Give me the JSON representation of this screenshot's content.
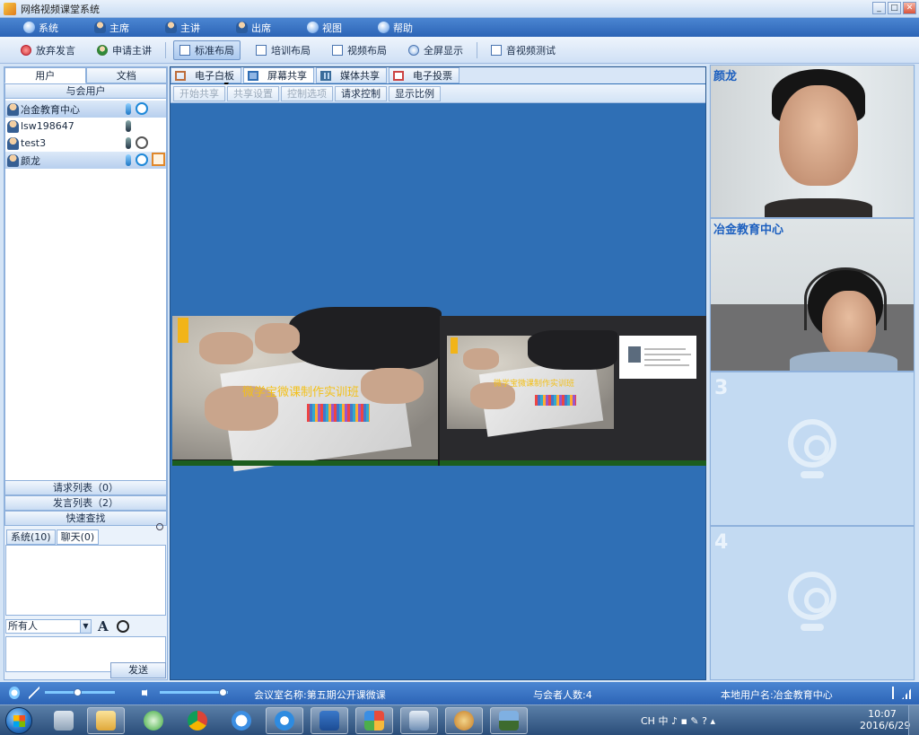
{
  "window": {
    "title": "网络视频课堂系统",
    "controls": [
      "_",
      "□",
      "✕"
    ]
  },
  "menu": [
    {
      "label": "系统",
      "icon": "gear-icon"
    },
    {
      "label": "主席",
      "icon": "person-icon"
    },
    {
      "label": "主讲",
      "icon": "person-icon"
    },
    {
      "label": "出席",
      "icon": "person-icon"
    },
    {
      "label": "视图",
      "icon": "monitor-icon"
    },
    {
      "label": "帮助",
      "icon": "info-icon"
    }
  ],
  "toolbar": [
    {
      "label": "放弃发言",
      "icon": "mic-off-icon",
      "active": false
    },
    {
      "label": "申请主讲",
      "icon": "user-icon",
      "active": false
    },
    {
      "label": "标准布局",
      "icon": "layout-icon",
      "active": true
    },
    {
      "label": "培训布局",
      "icon": "layout-icon",
      "active": false
    },
    {
      "label": "视频布局",
      "icon": "grid-icon",
      "active": false
    },
    {
      "label": "全屏显示",
      "icon": "fullscreen-icon",
      "active": false
    },
    {
      "label": "音视频测试",
      "icon": "av-test-icon",
      "active": false
    }
  ],
  "left": {
    "tabs": [
      "用户",
      "文档"
    ],
    "attendees_header": "与会用户",
    "users": [
      {
        "name": "冶金教育中心",
        "highlight": true
      },
      {
        "name": "lsw198647",
        "highlight": false
      },
      {
        "name": "test3",
        "highlight": false
      },
      {
        "name": "颜龙",
        "highlight": true
      }
    ],
    "request_list": "请求列表（0）",
    "speak_list": "发言列表（2）",
    "quick_search": "快速查找",
    "chat_tabs": [
      "系统(10)",
      "聊天(0)"
    ],
    "recipient": "所有人",
    "font_glyph": "A",
    "send": "发送"
  },
  "center": {
    "tabs": [
      "电子白板",
      "屏幕共享",
      "媒体共享",
      "电子投票"
    ],
    "subtoolbar": [
      {
        "label": "开始共享",
        "disabled": true
      },
      {
        "label": "共享设置",
        "disabled": true
      },
      {
        "label": "控制选项",
        "disabled": true
      },
      {
        "label": "请求控制",
        "disabled": false
      },
      {
        "label": "显示比例",
        "disabled": false
      }
    ],
    "shared_text": "微学宝微课制作实训班",
    "shared_text_small": "微学宝微课制作实训班"
  },
  "videos": [
    {
      "name": "颜龙"
    },
    {
      "name": "冶金教育中心"
    },
    {
      "number": "3"
    },
    {
      "number": "4"
    }
  ],
  "status": {
    "meeting": "会议室名称:第五期公开课微课",
    "count": "与会者人数:4",
    "local_user": "本地用户名:冶金教育中心"
  },
  "taskbar": {
    "tray": "CH 中 ♪ ▪ ✎ ? ▴",
    "time": "10:07",
    "date": "2016/6/29"
  }
}
